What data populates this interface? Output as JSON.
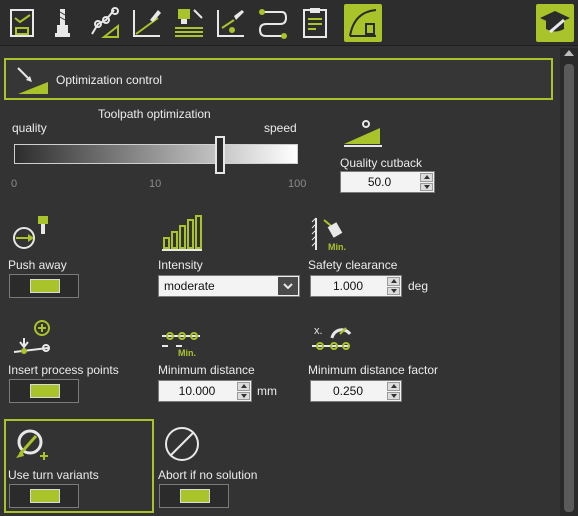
{
  "toolbar": {
    "icons": [
      "document-settings-icon",
      "tool-icon",
      "path-measure-icon",
      "drive-surface-icon",
      "tool-holder-icon",
      "tool-axis-icon",
      "links-icon",
      "checklist-icon",
      "optimization-icon"
    ],
    "right_icon": "graduation-cap-icon"
  },
  "section": {
    "title": "Optimization control"
  },
  "toolpath": {
    "title": "Toolpath optimization",
    "left_label": "quality",
    "right_label": "speed",
    "tick_0": "0",
    "tick_10": "10",
    "tick_100": "100",
    "level_percent": 73
  },
  "quality_cutback": {
    "label": "Quality cutback",
    "value": "50.0"
  },
  "push_away": {
    "label": "Push away",
    "enabled": true
  },
  "intensity": {
    "label": "Intensity",
    "value": "moderate"
  },
  "safety_clearance": {
    "label": "Safety clearance",
    "value": "1.000",
    "unit": "deg"
  },
  "insert_points": {
    "label": "Insert process points",
    "enabled": true
  },
  "min_distance": {
    "label": "Minimum distance",
    "value": "10.000",
    "unit": "mm"
  },
  "min_distance_factor": {
    "label": "Minimum distance factor",
    "value": "0.250"
  },
  "turn_variants": {
    "label": "Use turn variants",
    "enabled": true
  },
  "abort": {
    "label": "Abort if no solution",
    "enabled": true
  },
  "colors": {
    "accent": "#a9c32a",
    "background": "#333333"
  }
}
